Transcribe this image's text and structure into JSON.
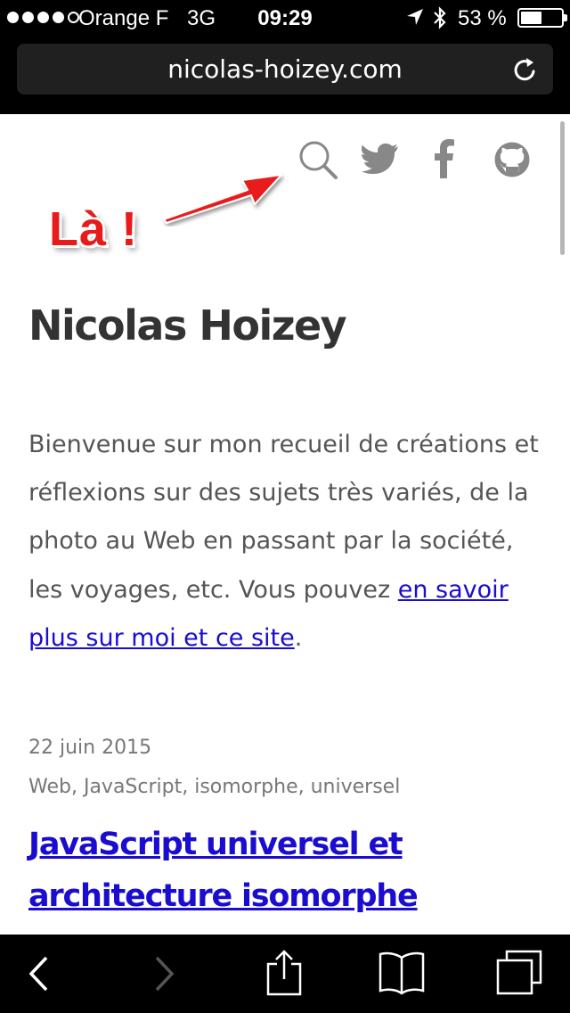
{
  "status_bar": {
    "signal_dots": 5,
    "signal_filled": 4,
    "carrier": "Orange F",
    "network": "3G",
    "time": "09:29",
    "battery": "53 %",
    "battery_level": 0.53
  },
  "address_bar": {
    "url": "nicolas-hoizey.com"
  },
  "header": {
    "icons": [
      "search-icon",
      "twitter-icon",
      "facebook-icon",
      "github-icon"
    ]
  },
  "annotation": {
    "label": "Là !",
    "color": "#e81b1b"
  },
  "site": {
    "title": "Nicolas Hoizey",
    "intro_text": "Bienvenue sur mon recueil de créations et réflexions sur des sujets très variés, de la photo au Web en passant par la société, les voyages, etc. Vous pouvez ",
    "intro_link": "en savoir plus sur moi et ce site",
    "intro_end": ".",
    "link_color": "#1a0dcf"
  },
  "post": {
    "date": "22 juin 2015",
    "tags": "Web, JavaScript, isomorphe, universel",
    "title": "JavaScript universel et architecture isomorphe"
  },
  "toolbar": {
    "icons": [
      "back-icon",
      "forward-icon",
      "share-icon",
      "bookmarks-icon",
      "tabs-icon"
    ]
  }
}
